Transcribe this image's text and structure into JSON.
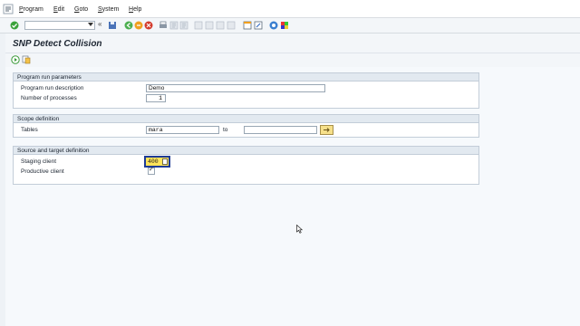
{
  "menu": {
    "items": [
      {
        "label": "Program",
        "underline": "P",
        "rest": "rogram"
      },
      {
        "label": "Edit",
        "underline": "E",
        "rest": "dit"
      },
      {
        "label": "Goto",
        "underline": "G",
        "rest": "oto"
      },
      {
        "label": "System",
        "underline": "S",
        "rest": "ystem"
      },
      {
        "label": "Help",
        "underline": "H",
        "rest": "elp"
      }
    ]
  },
  "toolbar": {
    "command_value": "",
    "double_arrow": "«"
  },
  "page": {
    "title": "SNP Detect Collision"
  },
  "groups": {
    "program_run": {
      "header": "Program run parameters",
      "description_label": "Program run description",
      "description_value": "Demo",
      "processes_label": "Number of processes",
      "processes_value": "1"
    },
    "scope": {
      "header": "Scope definition",
      "tables_label": "Tables",
      "tables_from": "mara",
      "to_label": "to",
      "tables_to": ""
    },
    "source_target": {
      "header": "Source and target definition",
      "staging_label": "Staging client",
      "staging_value": "400",
      "productive_label": "Productive client",
      "productive_checked": true
    }
  },
  "colors": {
    "accent": "#1e3c96",
    "highlight": "#ffe45a",
    "group_header": "#e2e9f0"
  }
}
